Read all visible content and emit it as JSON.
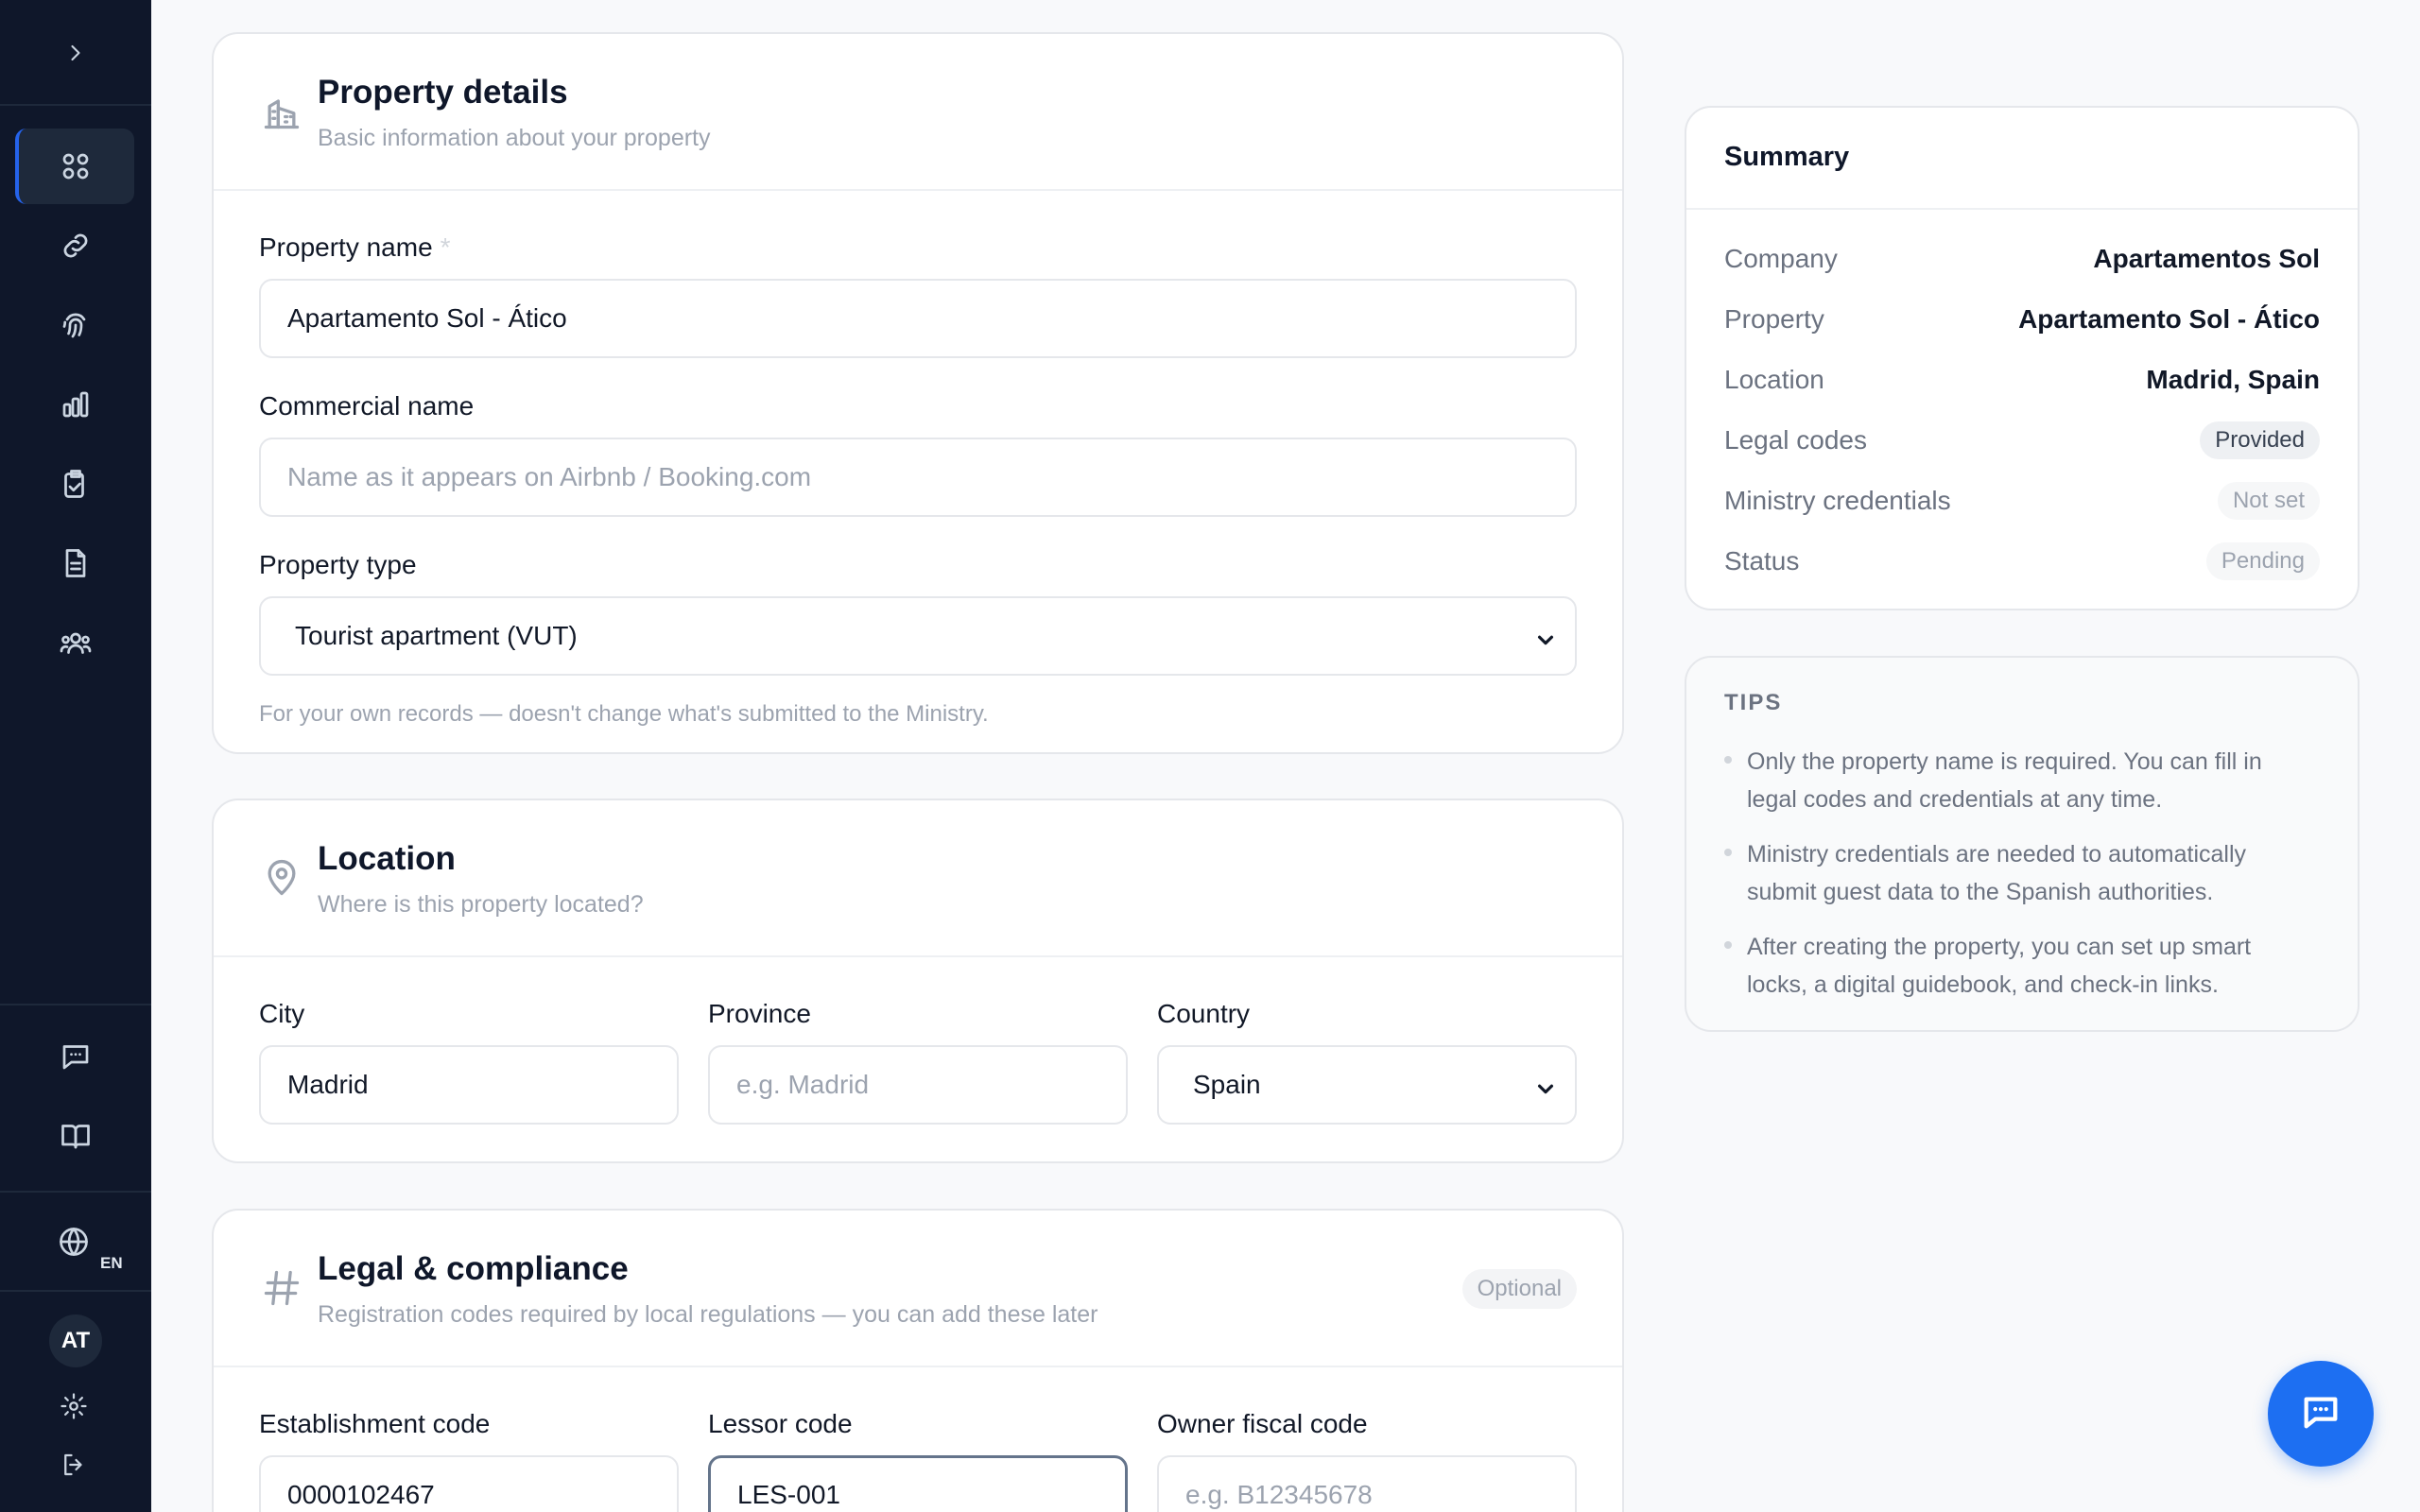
{
  "sidebar": {
    "items": [
      {
        "icon": "chevron-right-icon"
      },
      {
        "icon": "grid-icon"
      },
      {
        "icon": "link-icon"
      },
      {
        "icon": "fingerprint-icon"
      },
      {
        "icon": "bar-chart-icon"
      },
      {
        "icon": "clipboard-check-icon"
      },
      {
        "icon": "document-icon"
      },
      {
        "icon": "users-icon"
      },
      {
        "icon": "chat-icon"
      },
      {
        "icon": "book-icon"
      },
      {
        "icon": "globe-icon"
      },
      {
        "icon": "gear-icon"
      },
      {
        "icon": "logout-icon"
      }
    ],
    "language": "EN",
    "avatar_initials": "AT"
  },
  "property_details": {
    "title": "Property details",
    "subtitle": "Basic information about your property",
    "name_label": "Property name",
    "name_required": "*",
    "name_value": "Apartamento Sol - Ático",
    "commercial_label": "Commercial name",
    "commercial_placeholder": "Name as it appears on Airbnb / Booking.com",
    "type_label": "Property type",
    "type_value": "Tourist apartment (VUT)",
    "type_hint": "For your own records — doesn't change what's submitted to the Ministry."
  },
  "location": {
    "title": "Location",
    "subtitle": "Where is this property located?",
    "city_label": "City",
    "city_value": "Madrid",
    "province_label": "Province",
    "province_placeholder": "e.g. Madrid",
    "country_label": "Country",
    "country_value": "Spain"
  },
  "legal": {
    "title": "Legal & compliance",
    "subtitle": "Registration codes required by local regulations — you can add these later",
    "badge": "Optional",
    "establishment_label": "Establishment code",
    "establishment_value": "0000102467",
    "lessor_label": "Lessor code",
    "lessor_value": "LES-001",
    "owner_label": "Owner fiscal code",
    "owner_placeholder": "e.g. B12345678"
  },
  "summary": {
    "title": "Summary",
    "rows": [
      {
        "key": "Company",
        "value": "Apartamentos Sol"
      },
      {
        "key": "Property",
        "value": "Apartamento Sol - Ático"
      },
      {
        "key": "Location",
        "value": "Madrid, Spain"
      },
      {
        "key": "Legal codes",
        "value": "Provided"
      },
      {
        "key": "Ministry credentials",
        "value": "Not set"
      },
      {
        "key": "Status",
        "value": "Pending"
      }
    ]
  },
  "tips": {
    "title": "TIPS",
    "items": [
      "Only the property name is required. You can fill in legal codes and credentials at any time.",
      "Ministry credentials are needed to automatically submit guest data to the Spanish authorities.",
      "After creating the property, you can set up smart locks, a digital guidebook, and check-in links."
    ]
  },
  "fab": {
    "icon": "chat-bubble-icon"
  }
}
